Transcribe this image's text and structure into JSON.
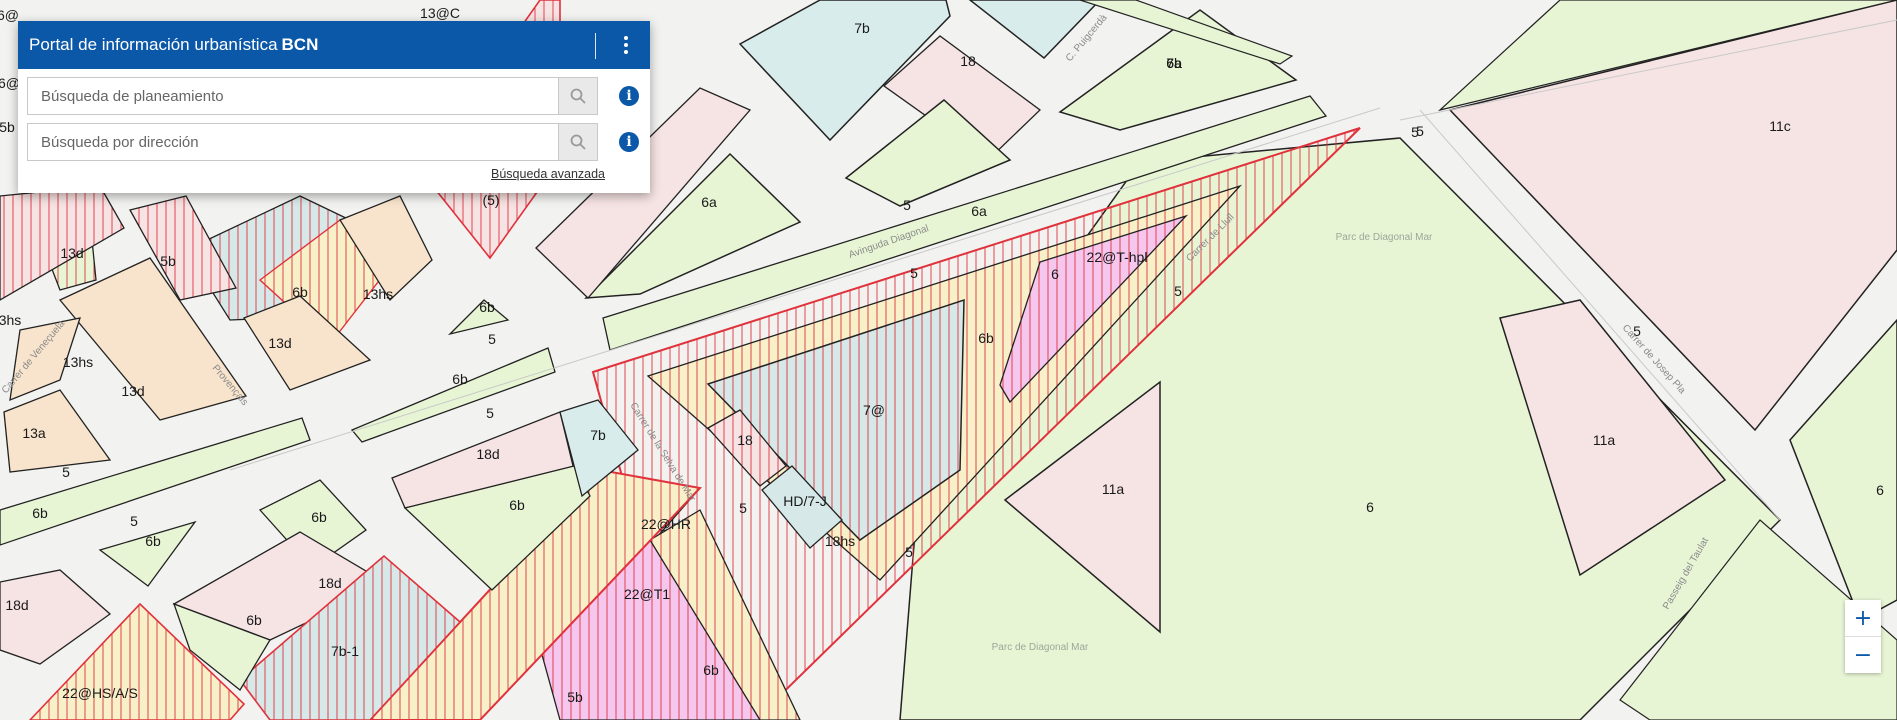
{
  "panel": {
    "title": "Portal de información urbanística",
    "title_strong": "BCN",
    "menu_icon": "vertical-dots-icon",
    "search_planning_placeholder": "Búsqueda de planeamiento",
    "search_address_placeholder": "Búsqueda por dirección",
    "search_icon": "magnifier-icon",
    "info_icon": "info-icon",
    "info_symbol": "i",
    "advanced_search_label": "Búsqueda avanzada"
  },
  "map": {
    "zone_labels": [
      "7b",
      "18",
      "6a",
      "5",
      "6a",
      "6a",
      "6a",
      "5",
      "5",
      "6",
      "22@T-hpl",
      "5",
      "7b",
      "13d",
      "5b",
      "6b",
      "13hs",
      "6b",
      "13d",
      "5",
      "6b",
      "13hs",
      "13d",
      "5",
      "13a",
      "6b",
      "18d",
      "7b",
      "7@",
      "18",
      "6b",
      "5",
      "HD/7-J",
      "18hs",
      "22@HR",
      "5",
      "5",
      "6b",
      "6b",
      "6b",
      "5",
      "18d",
      "22@T1",
      "6b",
      "7b-1",
      "18d",
      "6b",
      "5b",
      "22@HS/A/S",
      "11c",
      "5",
      "5",
      "11a",
      "11a",
      "6",
      "6",
      "3hs",
      "(5)",
      "6@",
      "13@C",
      "5b",
      "6@"
    ],
    "street_labels": [
      "Avinguda Diagonal",
      "Carrer de la Selva de Mar",
      "Carrer de Josep Pla",
      "Passeig del Taulat",
      "C. Puigcerdà",
      "Carrer de Llull",
      "Carrer de Veneçuela",
      "Provençals"
    ],
    "park_labels": [
      "Parc de Diagonal Mar",
      "Parc de Diagonal Mar"
    ],
    "colors": {
      "residential_pink": "#f6e3e3",
      "green_zone": "#e8f5d5",
      "equipment_blue": "#d9ecec",
      "industrial_orange": "#f8e4cc",
      "tech_magenta": "#f5c6ee",
      "hatch_red": "#e0323c",
      "accent_blue": "#0b57a8"
    }
  },
  "zoom": {
    "in_label": "+",
    "out_label": "−"
  }
}
